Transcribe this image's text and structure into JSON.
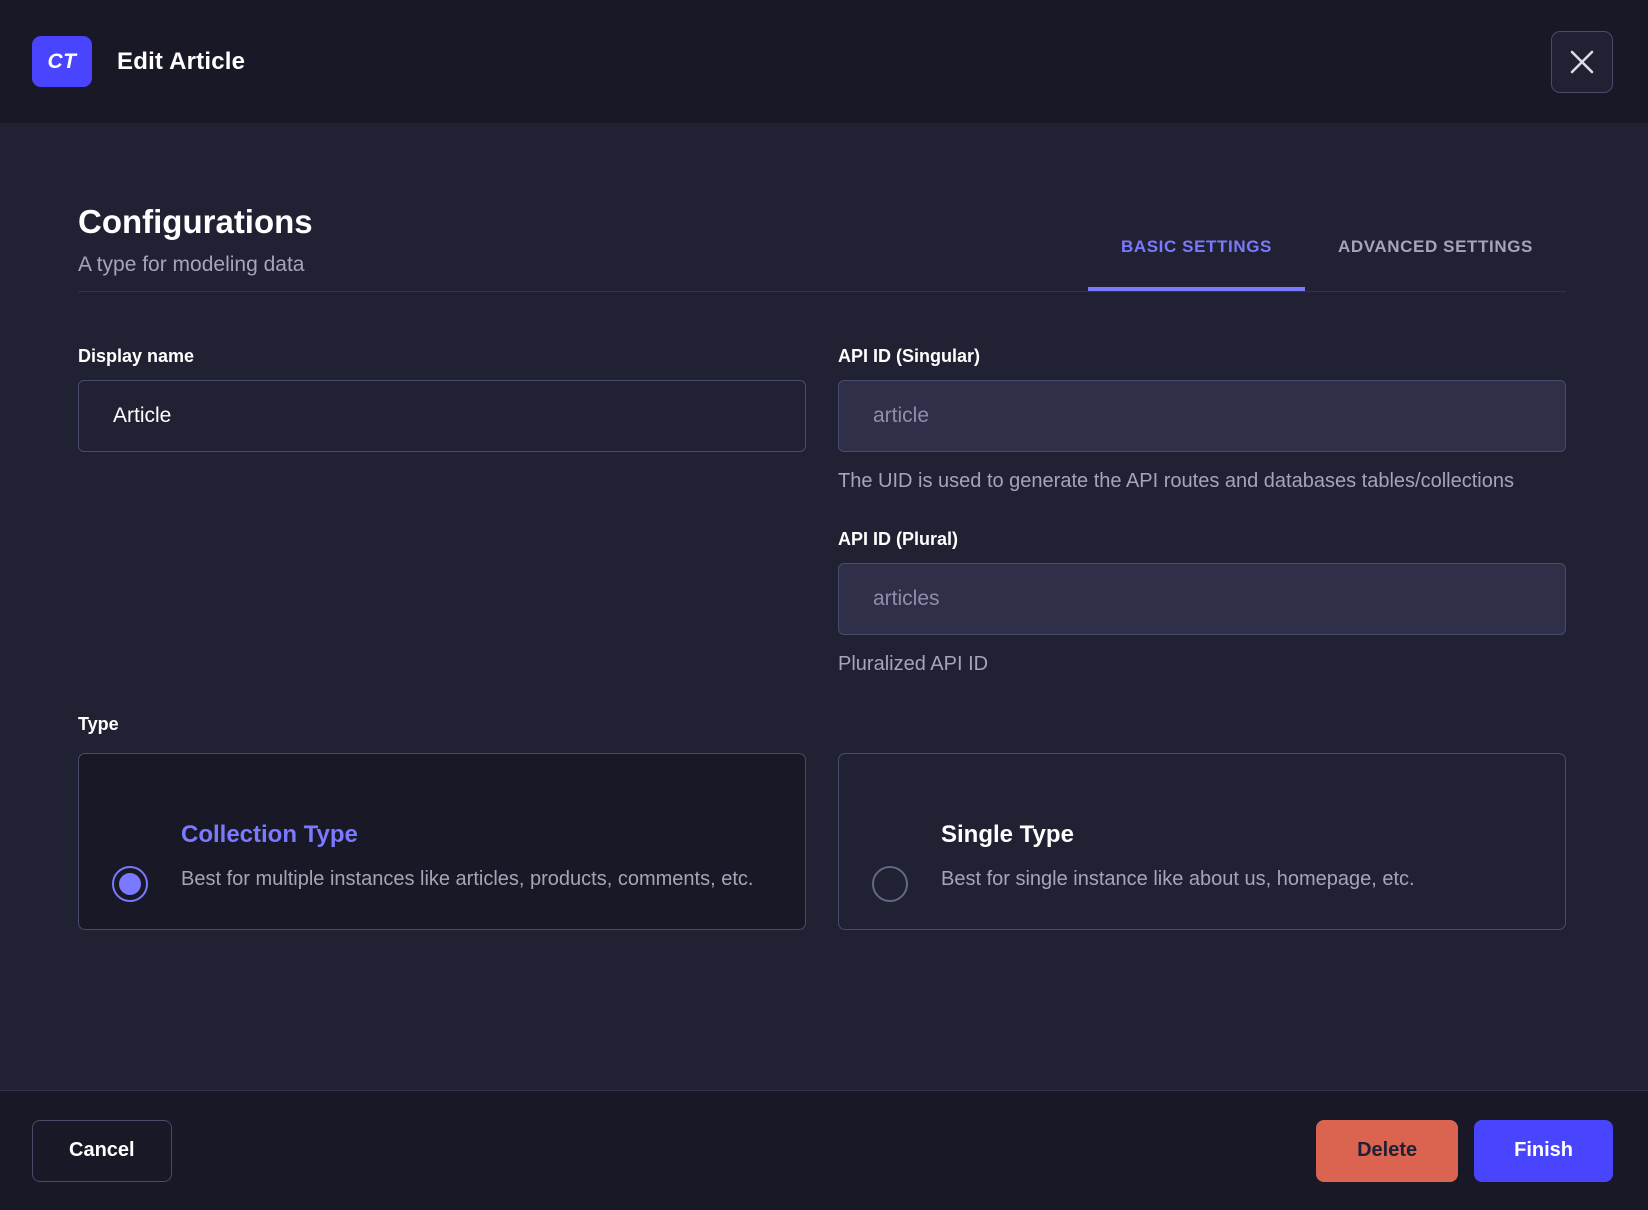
{
  "header": {
    "badge": "CT",
    "title": "Edit Article"
  },
  "main": {
    "title": "Configurations",
    "subtitle": "A type for modeling data",
    "tabs": [
      {
        "label": "BASIC SETTINGS",
        "active": true
      },
      {
        "label": "ADVANCED SETTINGS",
        "active": false
      }
    ],
    "fields": {
      "display_name": {
        "label": "Display name",
        "value": "Article"
      },
      "api_id_singular": {
        "label": "API ID (Singular)",
        "value": "article",
        "hint": "The UID is used to generate the API routes and databases tables/collections"
      },
      "api_id_plural": {
        "label": "API ID (Plural)",
        "value": "articles",
        "hint": "Pluralized API ID"
      }
    },
    "type_section": {
      "label": "Type",
      "options": [
        {
          "title": "Collection Type",
          "description": "Best for multiple instances like articles, products, comments, etc.",
          "selected": true
        },
        {
          "title": "Single Type",
          "description": "Best for single instance like about us, homepage, etc.",
          "selected": false
        }
      ]
    }
  },
  "footer": {
    "cancel_label": "Cancel",
    "delete_label": "Delete",
    "finish_label": "Finish"
  },
  "icons": {
    "close": "close-icon"
  },
  "colors": {
    "primary": "#4945ff",
    "primary_light": "#7b79ff",
    "danger": "#da6450",
    "background_dark": "#181826",
    "background_body": "#212134",
    "text_muted": "#a5a5ba"
  }
}
